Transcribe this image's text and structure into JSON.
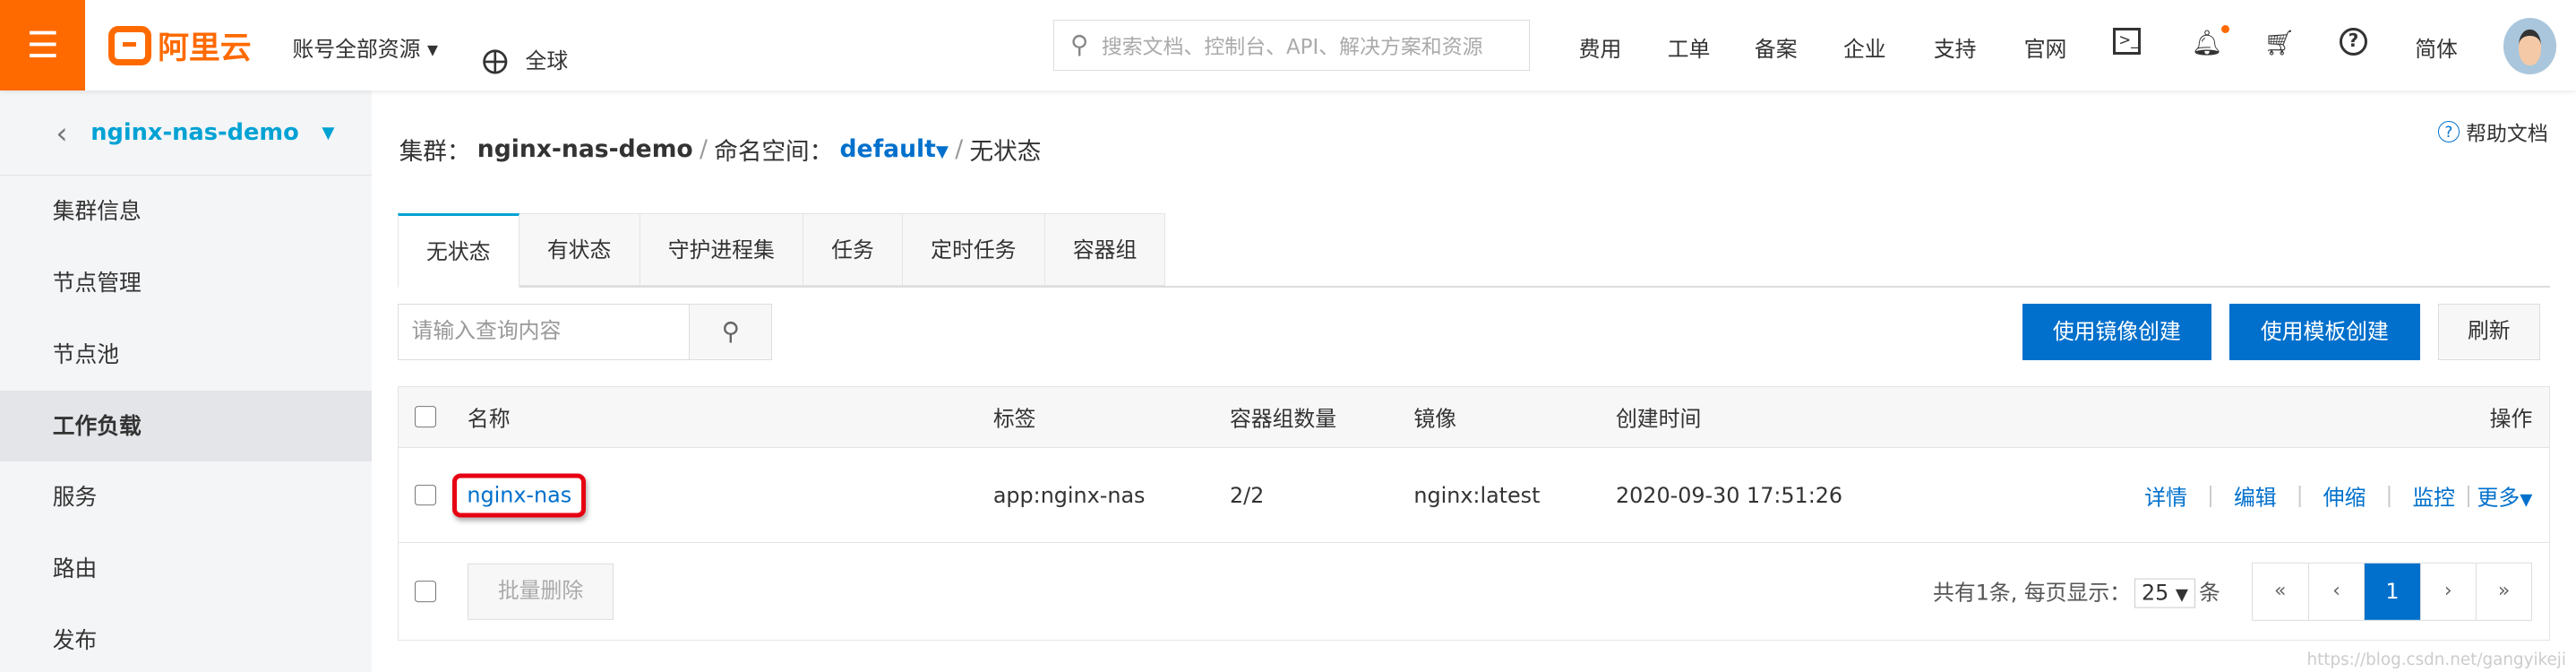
{
  "header": {
    "menu_icon": "hamburger-icon",
    "logo_text": "阿里云",
    "account_resources": "账号全部资源",
    "region": "全球",
    "search_placeholder": "搜索文档、控制台、API、解决方案和资源",
    "nav": [
      "费用",
      "工单",
      "备案",
      "企业",
      "支持",
      "官网"
    ],
    "language": "简体"
  },
  "sidebar": {
    "cluster": "nginx-nas-demo",
    "items": [
      {
        "label": "集群信息"
      },
      {
        "label": "节点管理"
      },
      {
        "label": "节点池"
      },
      {
        "label": "工作负载",
        "active": true
      },
      {
        "label": "服务"
      },
      {
        "label": "路由"
      },
      {
        "label": "发布"
      }
    ]
  },
  "breadcrumb": {
    "cluster_label": "集群：",
    "cluster": "nginx-nas-demo",
    "sep": "/",
    "ns_label": "命名空间：",
    "namespace": "default",
    "page": "无状态"
  },
  "help": "帮助文档",
  "tabs": [
    {
      "label": "无状态",
      "active": true
    },
    {
      "label": "有状态"
    },
    {
      "label": "守护进程集"
    },
    {
      "label": "任务"
    },
    {
      "label": "定时任务"
    },
    {
      "label": "容器组"
    }
  ],
  "toolbar": {
    "search_placeholder": "请输入查询内容",
    "create_image": "使用镜像创建",
    "create_template": "使用模板创建",
    "refresh": "刷新"
  },
  "table": {
    "columns": [
      "名称",
      "标签",
      "容器组数量",
      "镜像",
      "创建时间",
      "操作"
    ],
    "rows": [
      {
        "name": "nginx-nas",
        "label": "app:nginx-nas",
        "pods": "2/2",
        "image": "nginx:latest",
        "created": "2020-09-30 17:51:26",
        "actions": [
          "详情",
          "编辑",
          "伸缩",
          "监控",
          "更多"
        ]
      }
    ],
    "bulk_delete": "批量删除"
  },
  "pagination": {
    "total_text": "共有1条, 每页显示：",
    "page_size": "25",
    "unit": "条",
    "first": "«",
    "prev": "‹",
    "current": "1",
    "next": "›",
    "last": "»"
  },
  "watermark": "https://blog.csdn.net/gangyikeji",
  "colors": {
    "brand": "#ff6a00",
    "primary": "#0070cc",
    "highlight": "#e60012"
  }
}
